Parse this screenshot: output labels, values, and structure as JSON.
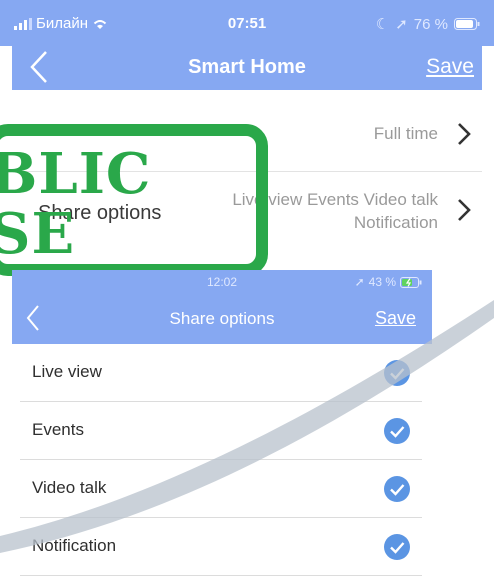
{
  "top_phone": {
    "status_bar": {
      "carrier": "Билайн",
      "time": "07:51",
      "battery": "76 %"
    },
    "nav": {
      "title": "Smart Home",
      "save_label": "Save"
    },
    "rows": [
      {
        "label": "",
        "value": "Full time"
      },
      {
        "label": "Share options",
        "value_line1": "Live view Events Video talk",
        "value_line2": "Notification"
      }
    ]
  },
  "stamp": {
    "line1": "BLIC",
    "line2": "SE"
  },
  "bottom_phone": {
    "status_bar": {
      "time": "12:02",
      "battery": "43 %"
    },
    "nav": {
      "title": "Share options",
      "save_label": "Save"
    },
    "options": [
      {
        "label": "Live view",
        "checked": true
      },
      {
        "label": "Events",
        "checked": true
      },
      {
        "label": "Video talk",
        "checked": true
      },
      {
        "label": "Notification",
        "checked": true
      }
    ]
  },
  "colors": {
    "header": "#86a8f2",
    "check": "#5b95e3",
    "stamp": "#2aa84a"
  }
}
